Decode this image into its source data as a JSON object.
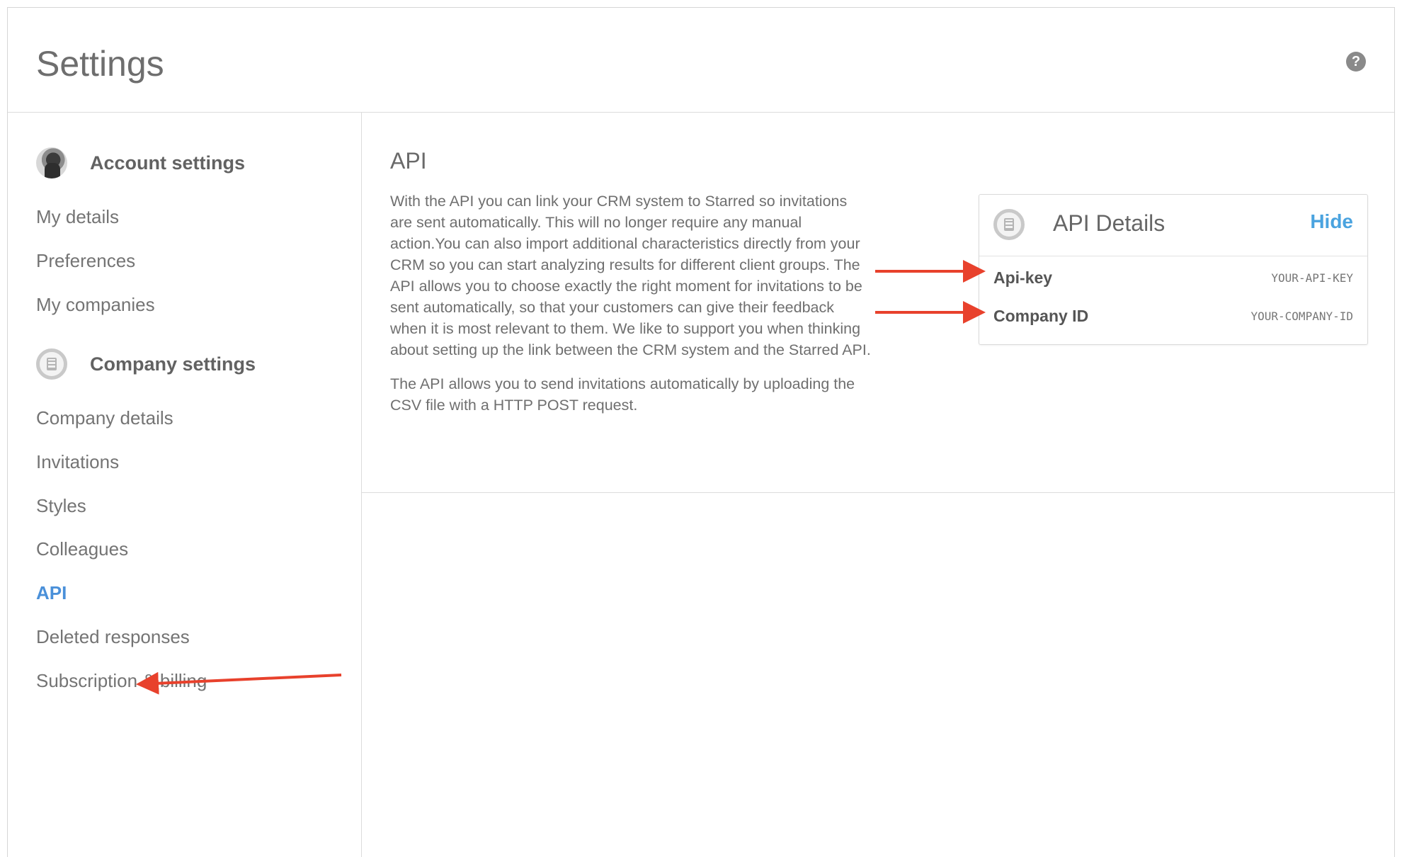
{
  "header": {
    "title": "Settings",
    "help_icon": "question-circle-icon",
    "help_glyph": "?"
  },
  "sidebar": {
    "account_section": {
      "title": "Account settings",
      "icon": "user-avatar",
      "items": [
        {
          "label": "My details"
        },
        {
          "label": "Preferences"
        },
        {
          "label": "My companies"
        }
      ]
    },
    "company_section": {
      "title": "Company settings",
      "icon": "building-icon",
      "items": [
        {
          "label": "Company details"
        },
        {
          "label": "Invitations"
        },
        {
          "label": "Styles"
        },
        {
          "label": "Colleagues"
        },
        {
          "label": "API",
          "active": true
        },
        {
          "label": "Deleted responses"
        },
        {
          "label": "Subscription & billing"
        }
      ]
    }
  },
  "main": {
    "title": "API",
    "paragraphs": [
      "With the API you can link your CRM system to Starred so invitations are sent automatically. This will no longer require any manual action.You can also import additional characteristics directly from your CRM so you can start analyzing results for different client groups. The API allows you to choose exactly the right moment for invitations to be sent automatically, so that your customers can give their feedback when it is most relevant to them. We like to support you when thinking about setting up the link between the CRM system and the Starred API.",
      "The API allows you to send invitations automatically by uploading the CSV file with a HTTP POST request."
    ]
  },
  "api_card": {
    "title": "API Details",
    "hide_label": "Hide",
    "rows": [
      {
        "label": "Api-key",
        "value": "YOUR-API-KEY"
      },
      {
        "label": "Company ID",
        "value": "YOUR-COMPANY-ID"
      }
    ]
  },
  "colors": {
    "accent": "#4a90d9",
    "link": "#4aa3df",
    "annotation_arrow": "#e8412c"
  }
}
